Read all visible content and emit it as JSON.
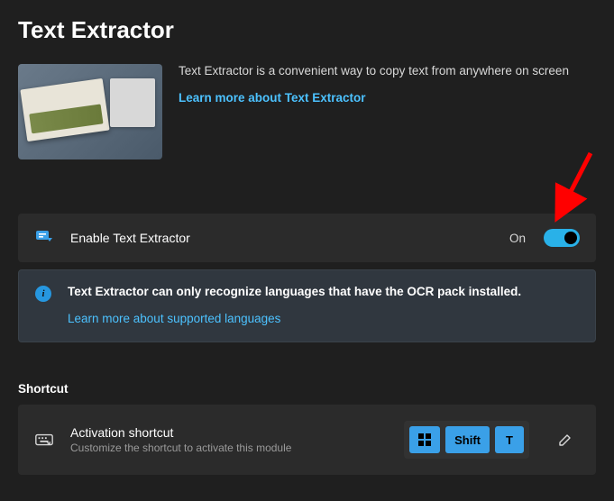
{
  "header": {
    "title": "Text Extractor"
  },
  "intro": {
    "description": "Text Extractor is a convenient way to copy text from anywhere on screen",
    "learn_more": "Learn more about Text Extractor"
  },
  "enable_card": {
    "label": "Enable Text Extractor",
    "state_text": "On",
    "enabled": true
  },
  "info_card": {
    "message": "Text Extractor can only recognize languages that have the OCR pack installed.",
    "link": "Learn more about supported languages"
  },
  "shortcut_section": {
    "heading": "Shortcut",
    "title": "Activation shortcut",
    "subtitle": "Customize the shortcut to activate this module",
    "keys": [
      "Win",
      "Shift",
      "T"
    ]
  },
  "annotation": {
    "arrow_color": "#ff0000"
  }
}
